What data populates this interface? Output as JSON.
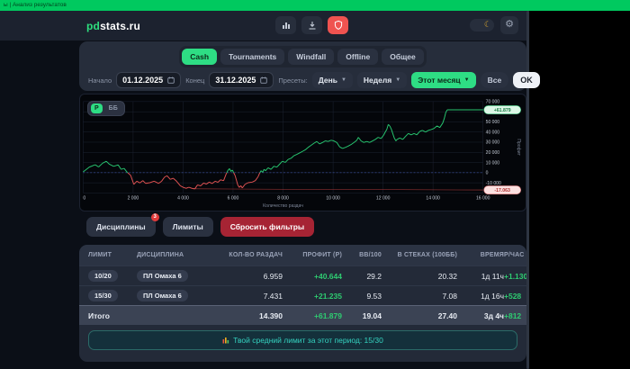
{
  "titlebar": {
    "text": "ы | Анализ результатов"
  },
  "header": {
    "logo_prefix": "pd",
    "logo_suffix": "stats.ru",
    "icons": [
      "stats-icon",
      "download-icon",
      "security-icon",
      "theme-toggle-moon",
      "settings-gear"
    ]
  },
  "tabs": [
    {
      "label": "Cash",
      "active": true
    },
    {
      "label": "Tournaments",
      "active": false
    },
    {
      "label": "Windfall",
      "active": false
    },
    {
      "label": "Offline",
      "active": false
    },
    {
      "label": "Общее",
      "active": false
    }
  ],
  "filters": {
    "start_label": "Начало",
    "start_value": "01.12.2025",
    "end_label": "Конец",
    "end_value": "31.12.2025",
    "presets_label": "Пресеты:",
    "preset_day": "День",
    "preset_week": "Неделя",
    "preset_month": "Этот месяц",
    "all_label": "Все",
    "ok_label": "OK"
  },
  "chart_data": {
    "type": "line",
    "title": "",
    "xlabel": "Количество раздач",
    "ylabel": "Профит",
    "unit_toggle": {
      "options": [
        "Р",
        "ББ"
      ],
      "active": "Р"
    },
    "xlim": [
      0,
      16000
    ],
    "ylim": [
      -20000,
      70000
    ],
    "x_ticks": {
      "values": [
        0,
        2000,
        4000,
        6000,
        8000,
        10000,
        12000,
        14000,
        16000
      ],
      "labels": [
        "0",
        "2 000",
        "4 000",
        "6 000",
        "8 000",
        "10 000",
        "12 000",
        "14 000",
        "16 000"
      ]
    },
    "y_ticks": {
      "values": [
        70000,
        60000,
        50000,
        40000,
        30000,
        20000,
        10000,
        0,
        -10000,
        -20000
      ],
      "labels": [
        "70 000",
        "60 000",
        "50 000",
        "40 000",
        "30 000",
        "20 000",
        "10 000",
        "0",
        "-10 000",
        "-20 000"
      ]
    },
    "grid": true,
    "zero_line": {
      "style": "dashed",
      "color": "#4a63c8"
    },
    "end_label": {
      "text": "+61.879",
      "value": 61879
    },
    "min_label": {
      "text": "-17.063",
      "value": -17063
    },
    "series": [
      {
        "name": "profit-cumulative",
        "positive_color": "#27c46f",
        "negative_color": "#e05252",
        "points": [
          [
            0,
            800
          ],
          [
            250,
            5500
          ],
          [
            480,
            7800
          ],
          [
            620,
            5600
          ],
          [
            780,
            9300
          ],
          [
            930,
            11200
          ],
          [
            1050,
            8300
          ],
          [
            1220,
            6200
          ],
          [
            1400,
            7700
          ],
          [
            1520,
            3300
          ],
          [
            1640,
            4200
          ],
          [
            1760,
            500
          ],
          [
            1900,
            -2500
          ],
          [
            2030,
            -11500
          ],
          [
            2150,
            -8400
          ],
          [
            2270,
            -10100
          ],
          [
            2390,
            -7800
          ],
          [
            2500,
            -10600
          ],
          [
            2670,
            -9900
          ],
          [
            2840,
            -8400
          ],
          [
            3020,
            -10600
          ],
          [
            3140,
            -8400
          ],
          [
            3260,
            -4300
          ],
          [
            3360,
            -3000
          ],
          [
            3490,
            -6600
          ],
          [
            3600,
            -5500
          ],
          [
            3720,
            -8000
          ],
          [
            3890,
            -12900
          ],
          [
            4010,
            -14500
          ],
          [
            4120,
            -15400
          ],
          [
            4230,
            -14400
          ],
          [
            4350,
            -15400
          ],
          [
            4470,
            -15900
          ],
          [
            4580,
            -12000
          ],
          [
            4700,
            -13000
          ],
          [
            4820,
            -10200
          ],
          [
            4930,
            -11300
          ],
          [
            5050,
            -9300
          ],
          [
            5160,
            -10700
          ],
          [
            5280,
            -8400
          ],
          [
            5390,
            -9500
          ],
          [
            5500,
            -7000
          ],
          [
            5620,
            -8000
          ],
          [
            5730,
            -1000
          ],
          [
            5800,
            2500
          ],
          [
            5860,
            4000
          ],
          [
            5910,
            1200
          ],
          [
            5970,
            2600
          ],
          [
            6080,
            -2800
          ],
          [
            6190,
            -12200
          ],
          [
            6250,
            -14500
          ],
          [
            6310,
            -12800
          ],
          [
            6370,
            -15100
          ],
          [
            6480,
            -11400
          ],
          [
            6600,
            -9900
          ],
          [
            6770,
            -9300
          ],
          [
            6890,
            -7800
          ],
          [
            7000,
            -4000
          ],
          [
            7060,
            -500
          ],
          [
            7120,
            2000
          ],
          [
            7180,
            300
          ],
          [
            7240,
            3300
          ],
          [
            7300,
            1900
          ],
          [
            7400,
            4800
          ],
          [
            7520,
            3300
          ],
          [
            7630,
            6300
          ],
          [
            7750,
            5400
          ],
          [
            7860,
            8300
          ],
          [
            7970,
            11200
          ],
          [
            8090,
            10100
          ],
          [
            8200,
            13000
          ],
          [
            8320,
            14200
          ],
          [
            8430,
            16600
          ],
          [
            8550,
            18000
          ],
          [
            8660,
            19500
          ],
          [
            8780,
            21000
          ],
          [
            8890,
            22500
          ],
          [
            9000,
            24800
          ],
          [
            9120,
            26900
          ],
          [
            9230,
            28900
          ],
          [
            9350,
            30700
          ],
          [
            9460,
            28300
          ],
          [
            9580,
            29800
          ],
          [
            9690,
            31300
          ],
          [
            9800,
            30700
          ],
          [
            9920,
            31900
          ],
          [
            10030,
            31300
          ],
          [
            10150,
            29800
          ],
          [
            10260,
            25400
          ],
          [
            10380,
            23900
          ],
          [
            10490,
            24800
          ],
          [
            10600,
            26000
          ],
          [
            10720,
            27700
          ],
          [
            10840,
            29800
          ],
          [
            10950,
            31900
          ],
          [
            11010,
            34800
          ],
          [
            11120,
            31300
          ],
          [
            11230,
            29800
          ],
          [
            11350,
            30700
          ],
          [
            11460,
            29800
          ],
          [
            11580,
            31300
          ],
          [
            11690,
            32700
          ],
          [
            11800,
            34800
          ],
          [
            11920,
            33600
          ],
          [
            12030,
            37200
          ],
          [
            12090,
            40100
          ],
          [
            12150,
            42500
          ],
          [
            12210,
            47500
          ],
          [
            12270,
            46000
          ],
          [
            12330,
            43000
          ],
          [
            12390,
            38600
          ],
          [
            12450,
            34200
          ],
          [
            12510,
            31300
          ],
          [
            12560,
            32700
          ],
          [
            12670,
            34200
          ],
          [
            12790,
            32700
          ],
          [
            12900,
            35700
          ],
          [
            13010,
            38600
          ],
          [
            13130,
            37200
          ],
          [
            13240,
            38600
          ],
          [
            13350,
            37200
          ],
          [
            13470,
            40700
          ],
          [
            13580,
            41600
          ],
          [
            13700,
            40100
          ],
          [
            13810,
            41600
          ],
          [
            13930,
            42500
          ],
          [
            14040,
            43600
          ],
          [
            14160,
            46000
          ],
          [
            14270,
            44500
          ],
          [
            14390,
            48900
          ],
          [
            14450,
            53300
          ],
          [
            14510,
            59200
          ],
          [
            14570,
            61879
          ],
          [
            16000,
            61879
          ]
        ]
      },
      {
        "name": "min-reference-line",
        "color": "#b03a3a",
        "points": [
          [
            4400,
            -15900
          ],
          [
            16000,
            -17063
          ]
        ]
      }
    ]
  },
  "filter_buttons": {
    "disciplines_label": "Дисциплины",
    "disciplines_badge": "3",
    "limits_label": "Лимиты",
    "reset_label": "Сбросить фильтры"
  },
  "table": {
    "columns": [
      "ЛИМИТ",
      "ДИСЦИПЛИНА",
      "КОЛ-ВО РАЗДАЧ",
      "ПРОФИТ (Р)",
      "BB/100",
      "В СТЕКАХ (100ББ)",
      "ВРЕМЯ",
      "Р/ЧАС"
    ],
    "rows": [
      {
        "limit": "10/20",
        "discipline": "ПЛ Омаха 6",
        "hands": "6.959",
        "profit": "+40.644",
        "bb100": "29.2",
        "stacks": "20.32",
        "time": "1д 11ч",
        "per_hour": "+1.130"
      },
      {
        "limit": "15/30",
        "discipline": "ПЛ Омаха 6",
        "hands": "7.431",
        "profit": "+21.235",
        "bb100": "9.53",
        "stacks": "7.08",
        "time": "1д 16ч",
        "per_hour": "+528"
      }
    ],
    "total": {
      "label": "Итого",
      "hands": "14.390",
      "profit": "+61.879",
      "bb100": "19.04",
      "stacks": "27.40",
      "time": "3д 4ч",
      "per_hour": "+812"
    }
  },
  "footer": {
    "text": "Твой средний лимит за этот период: 15/30"
  }
}
